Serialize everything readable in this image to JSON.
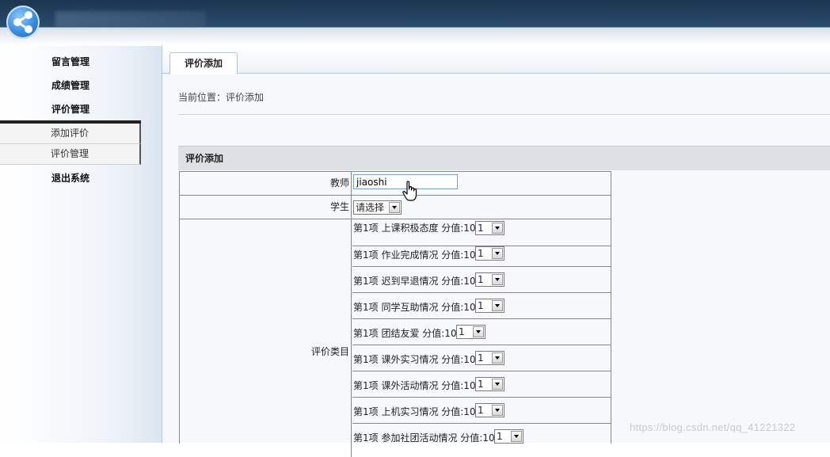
{
  "sidebar": {
    "items": [
      {
        "label": "留言管理"
      },
      {
        "label": "成绩管理"
      },
      {
        "label": "评价管理"
      }
    ],
    "submenu": [
      {
        "label": "添加评价"
      },
      {
        "label": "评价管理"
      }
    ],
    "logout": "退出系统"
  },
  "main": {
    "tab": "评价添加",
    "breadcrumb": "当前位置：评价添加",
    "section_title": "评价添加",
    "form": {
      "teacher_label": "教师",
      "teacher_value": "jiaoshi",
      "student_label": "学生",
      "student_select": "请选择",
      "category_label": "评价类目",
      "items": [
        {
          "label": "第1项 上课积极态度 分值:10",
          "value": "1"
        },
        {
          "label": "第1项 作业完成情况 分值:10",
          "value": "1"
        },
        {
          "label": "第1项 迟到早退情况 分值:10",
          "value": "1"
        },
        {
          "label": "第1项 同学互助情况 分值:10",
          "value": "1"
        },
        {
          "label": "第1项 团结友爱 分值:10",
          "value": "1"
        },
        {
          "label": "第1项 课外实习情况 分值:10",
          "value": "1"
        },
        {
          "label": "第1项 课外活动情况 分值:10",
          "value": "1"
        },
        {
          "label": "第1项 上机实习情况 分值:10",
          "value": "1"
        },
        {
          "label": "第1项 参加社团活动情况 分值:10",
          "value": "1"
        }
      ]
    }
  },
  "watermark": "https://blog.csdn.net/qq_41221322"
}
